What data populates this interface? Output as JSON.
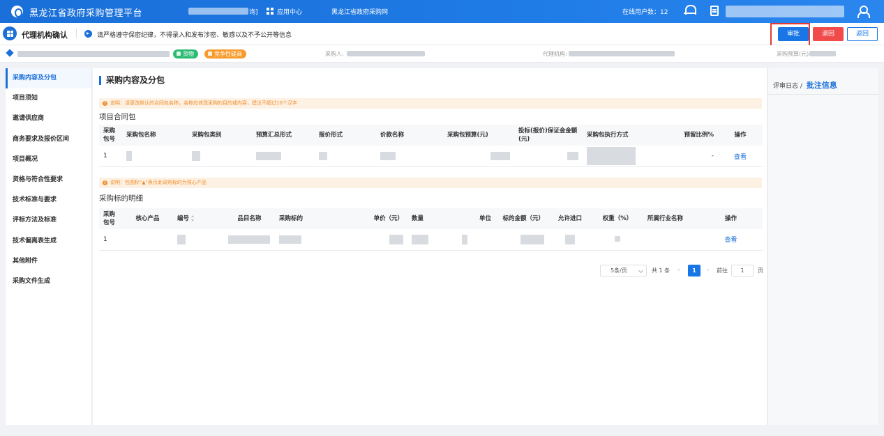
{
  "topbar": {
    "title": "黑龙江省政府采购管理平台",
    "user_suffix": "询]",
    "app_center": "应用中心",
    "site_link": "黑龙江省政府采购网",
    "online_users": "在线用户数：12"
  },
  "subbar": {
    "page_title": "代理机构确认",
    "notice": "请严格遵守保密纪律，不得录入和发布涉密、敏感以及不予公开等信息",
    "approve": "审批",
    "reject": "退回",
    "back": "返回"
  },
  "infobar": {
    "tag_goods": "货物",
    "tag_method": "竞争性磋商",
    "purchaser_label": "采购人:",
    "agency_label": "代理机构:",
    "budget_label": "采购预算(元):"
  },
  "sidebar": {
    "items": [
      {
        "label": "采购内容及分包"
      },
      {
        "label": "项目须知"
      },
      {
        "label": "邀请供应商"
      },
      {
        "label": "商务要求及报价区间"
      },
      {
        "label": "项目概况"
      },
      {
        "label": "资格与符合性要求"
      },
      {
        "label": "技术标准与要求"
      },
      {
        "label": "评标方法及标准"
      },
      {
        "label": "技术偏离表生成"
      },
      {
        "label": "其他附件"
      },
      {
        "label": "采购文件生成"
      }
    ]
  },
  "main": {
    "section_title": "采购内容及分包",
    "note1": "说明：请更改默认的合同包名称，名称应体现采购的目的或内容，建议不超过10个汉字",
    "sub1": "项目合同包",
    "table1": {
      "headers": [
        "采购包号",
        "采购包名称",
        "采购包类别",
        "预算汇总形式",
        "报价形式",
        "价款名称",
        "采购包预算(元)",
        "投标(报价)保证金金额(元)",
        "采购包执行方式",
        "预留比例%",
        "操作"
      ],
      "row": {
        "no": "1",
        "reserve": "-",
        "action": "查看"
      }
    },
    "note2": "说明：包图标\"▲\"表示此采购标的为核心产品",
    "sub2": "采购标的明细",
    "table2": {
      "headers": [
        "采购包号",
        "核心产品",
        "编号",
        "品目名称",
        "采购标的",
        "单价（元）",
        "数量",
        "单位",
        "标的金额（元）",
        "允许进口",
        "权重（%）",
        "所属行业名称",
        "操作"
      ],
      "row": {
        "no": "1",
        "action": "查看"
      }
    },
    "pager": {
      "page_size": "5条/页",
      "total": "共 1 条",
      "current": "1",
      "goto": "前往",
      "goto_value": "1",
      "page_word": "页"
    }
  },
  "right_panel": {
    "log_label": "评审日志 /",
    "notes_label": "批注信息"
  },
  "colors": {
    "primary": "#1976e6",
    "danger": "#f04a4a",
    "highlight": "#e53935",
    "success": "#2dbb74",
    "warning": "#f79b2c"
  }
}
